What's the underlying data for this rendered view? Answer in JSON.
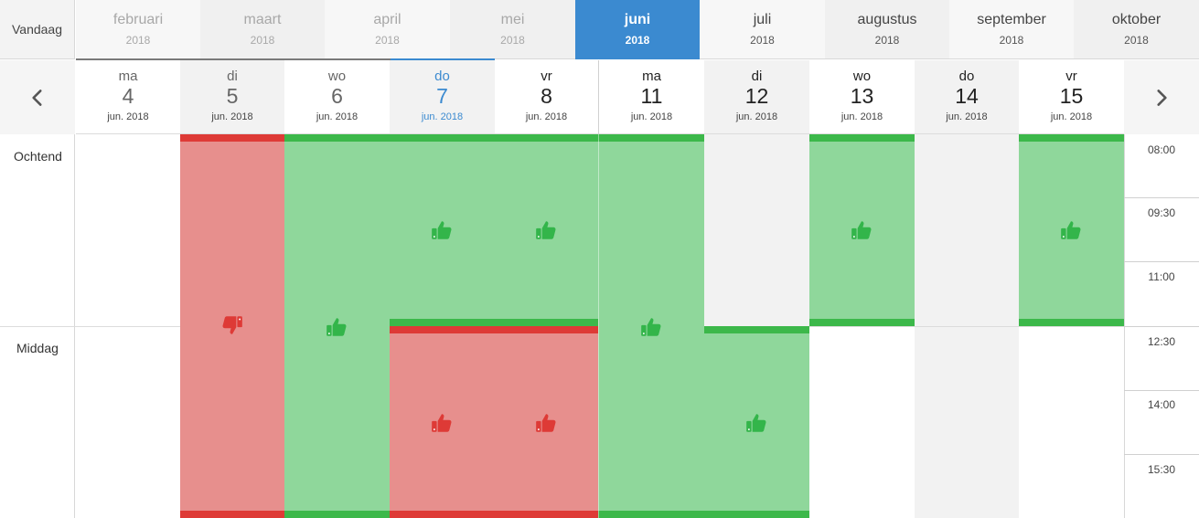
{
  "toolbar": {
    "today_label": "Vandaag"
  },
  "months": [
    {
      "name": "februari",
      "year": "2018",
      "state": "past"
    },
    {
      "name": "maart",
      "year": "2018",
      "state": "past"
    },
    {
      "name": "april",
      "year": "2018",
      "state": "past"
    },
    {
      "name": "mei",
      "year": "2018",
      "state": "past"
    },
    {
      "name": "juni",
      "year": "2018",
      "state": "active"
    },
    {
      "name": "juli",
      "year": "2018",
      "state": "future"
    },
    {
      "name": "augustus",
      "year": "2018",
      "state": "future"
    },
    {
      "name": "september",
      "year": "2018",
      "state": "future"
    },
    {
      "name": "oktober",
      "year": "2018",
      "state": "future"
    }
  ],
  "nav": {
    "prev_icon": "chevron-left-icon",
    "next_icon": "chevron-right-icon"
  },
  "days": [
    {
      "dow": "ma",
      "num": "4",
      "month": "jun. 2018",
      "state": "grey"
    },
    {
      "dow": "di",
      "num": "5",
      "month": "jun. 2018",
      "state": "grey"
    },
    {
      "dow": "wo",
      "num": "6",
      "month": "jun. 2018",
      "state": "grey"
    },
    {
      "dow": "do",
      "num": "7",
      "month": "jun. 2018",
      "state": "today"
    },
    {
      "dow": "vr",
      "num": "8",
      "month": "jun. 2018",
      "state": "dark"
    },
    {
      "dow": "ma",
      "num": "11",
      "month": "jun. 2018",
      "state": "dark"
    },
    {
      "dow": "di",
      "num": "12",
      "month": "jun. 2018",
      "state": "dark"
    },
    {
      "dow": "wo",
      "num": "13",
      "month": "jun. 2018",
      "state": "dark"
    },
    {
      "dow": "do",
      "num": "14",
      "month": "jun. 2018",
      "state": "dark"
    },
    {
      "dow": "vr",
      "num": "15",
      "month": "jun. 2018",
      "state": "dark"
    }
  ],
  "periods": {
    "morning": "Ochtend",
    "afternoon": "Middag"
  },
  "times": [
    "08:00",
    "09:30",
    "11:00",
    "12:30",
    "14:00",
    "15:30"
  ],
  "availability": [
    {
      "day": "5",
      "period": "morning-afternoon",
      "status": "unavailable",
      "icon": "thumbs-down-icon"
    },
    {
      "day": "6",
      "period": "morning-afternoon",
      "status": "available",
      "icon": "thumbs-up-icon"
    },
    {
      "day": "7",
      "period": "morning",
      "status": "available",
      "icon": "thumbs-up-icon"
    },
    {
      "day": "8",
      "period": "morning",
      "status": "available",
      "icon": "thumbs-up-icon"
    },
    {
      "day": "7",
      "period": "afternoon",
      "status": "conflict",
      "icon": "thumbs-up-icon"
    },
    {
      "day": "8",
      "period": "afternoon",
      "status": "conflict",
      "icon": "thumbs-up-icon"
    },
    {
      "day": "11",
      "period": "morning-afternoon",
      "status": "available",
      "icon": "thumbs-up-icon"
    },
    {
      "day": "12",
      "period": "afternoon",
      "status": "available",
      "icon": "thumbs-up-icon"
    },
    {
      "day": "13",
      "period": "morning",
      "status": "available",
      "icon": "thumbs-up-icon"
    },
    {
      "day": "15",
      "period": "morning",
      "status": "available",
      "icon": "thumbs-up-icon"
    }
  ],
  "colors": {
    "accent": "#3b8ad0",
    "available_fill": "#8fd79b",
    "available_bar": "#3cb84a",
    "unavailable_fill": "#e78f8d",
    "unavailable_bar": "#de3a36",
    "thumb_up": "#33b54a",
    "thumb_down": "#de3a36"
  }
}
